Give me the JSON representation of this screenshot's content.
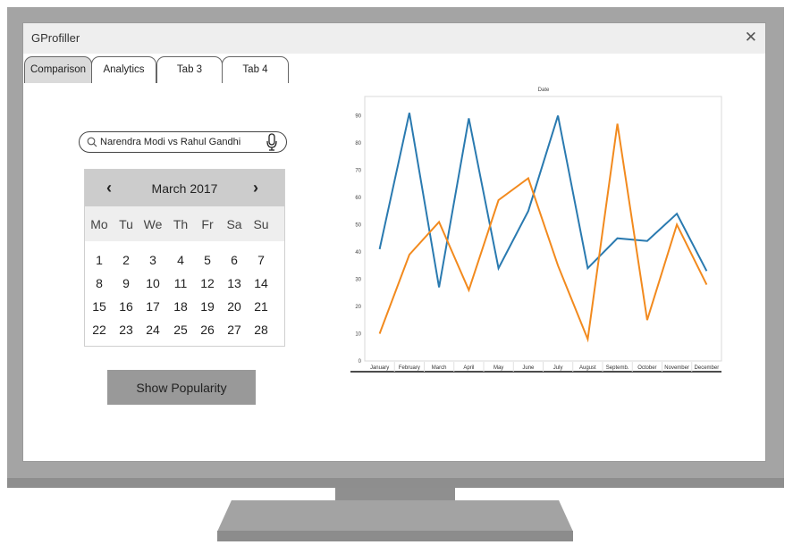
{
  "window": {
    "title": "GProfiller"
  },
  "tabs": [
    {
      "label": "Comparison",
      "active": true
    },
    {
      "label": "Analytics",
      "active": false
    },
    {
      "label": "Tab 3",
      "active": false
    },
    {
      "label": "Tab 4",
      "active": false
    }
  ],
  "search": {
    "value": "Narendra Modi vs Rahul Gandhi"
  },
  "icons": {
    "search": "search-icon",
    "mic": "microphone-icon",
    "close": "close-icon",
    "prev": "chevron-left-icon",
    "next": "chevron-right-icon"
  },
  "calendar": {
    "month_label": "March 2017",
    "prev_symbol": "‹",
    "next_symbol": "›",
    "day_names": [
      "Mo",
      "Tu",
      "We",
      "Th",
      "Fr",
      "Sa",
      "Su"
    ],
    "weeks": [
      [
        "1",
        "2",
        "3",
        "4",
        "5",
        "6",
        "7"
      ],
      [
        "8",
        "9",
        "10",
        "11",
        "12",
        "13",
        "14"
      ],
      [
        "15",
        "16",
        "17",
        "18",
        "19",
        "20",
        "21"
      ],
      [
        "22",
        "23",
        "24",
        "25",
        "26",
        "27",
        "28"
      ]
    ]
  },
  "button": {
    "label": "Show Popularity"
  },
  "colors": {
    "series1": "#2a7ab0",
    "series2": "#f28a1e"
  },
  "chart_data": {
    "type": "line",
    "title": "Date",
    "categories": [
      "January",
      "February",
      "March",
      "April",
      "May",
      "June",
      "July",
      "August",
      "Septemb.",
      "October",
      "November",
      "December"
    ],
    "series": [
      {
        "values": [
          41,
          91,
          27,
          89,
          34,
          55,
          90,
          34,
          45,
          44,
          54,
          33
        ]
      },
      {
        "values": [
          10,
          39,
          51,
          26,
          59,
          67,
          35,
          8,
          87,
          15,
          50,
          28
        ]
      }
    ],
    "yticks": [
      "0",
      "10",
      "20",
      "30",
      "40",
      "50",
      "60",
      "70",
      "80",
      "90"
    ],
    "ylim": [
      0,
      97
    ],
    "grid": false,
    "legend": "none"
  }
}
